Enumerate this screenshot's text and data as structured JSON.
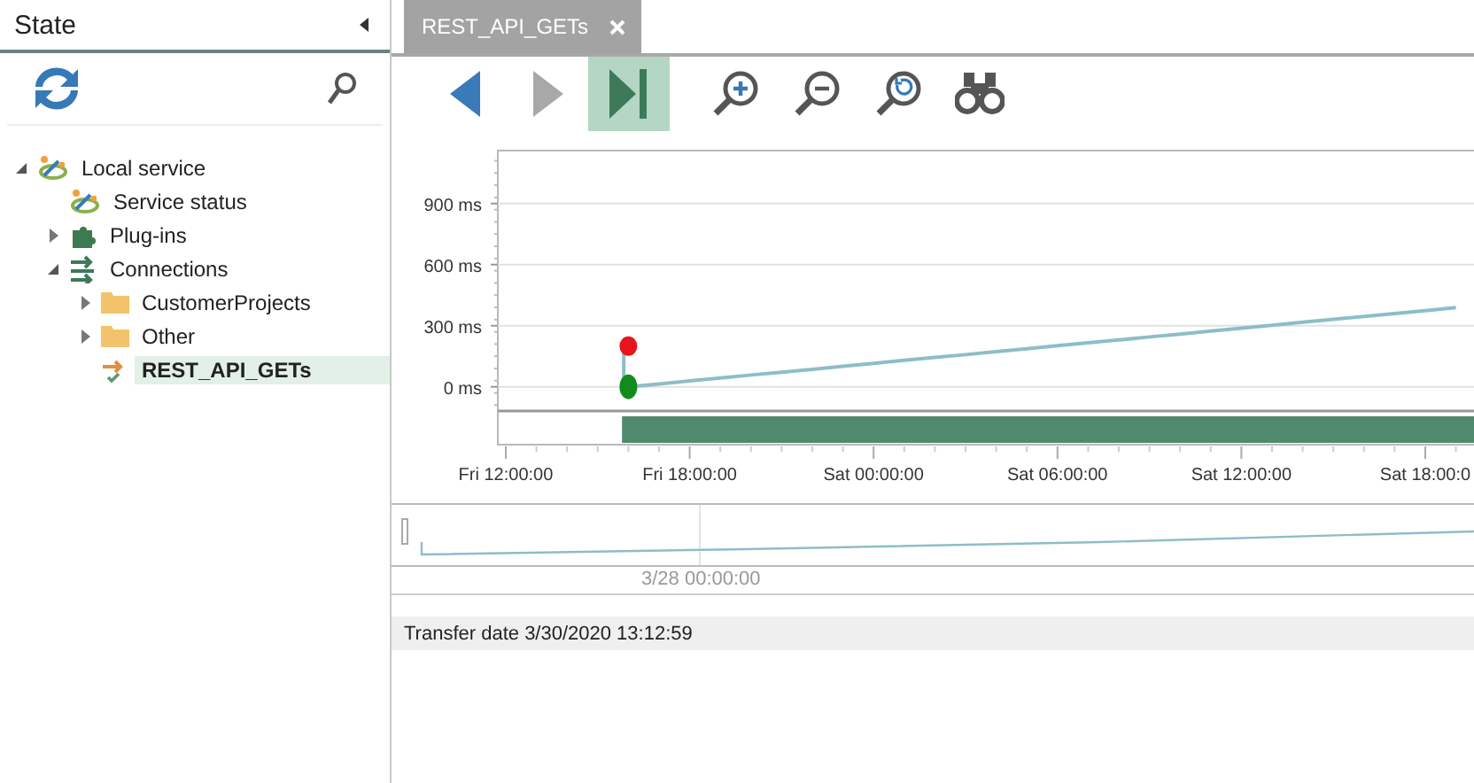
{
  "sidebar": {
    "title": "State",
    "tree": [
      {
        "label": "Local service",
        "kind": "service",
        "expanded": true,
        "selected": false,
        "children": [
          {
            "label": "Service status",
            "kind": "status",
            "selected": false
          },
          {
            "label": "Plug-ins",
            "kind": "plugin",
            "expanded": false,
            "selected": false
          },
          {
            "label": "Connections",
            "kind": "connections",
            "expanded": true,
            "selected": false,
            "children": [
              {
                "label": "CustomerProjects",
                "kind": "folder",
                "expanded": false,
                "selected": false
              },
              {
                "label": "Other",
                "kind": "folder",
                "expanded": false,
                "selected": false
              },
              {
                "label": "REST_API_GETs",
                "kind": "connection",
                "selected": true
              }
            ]
          }
        ]
      }
    ]
  },
  "tabs": [
    {
      "label": "REST_API_GETs",
      "selected": true
    }
  ],
  "toolbar": [
    {
      "kind": "back",
      "pressed": false,
      "disabled": false
    },
    {
      "kind": "forward",
      "pressed": false,
      "disabled": true
    },
    {
      "kind": "last",
      "pressed": true,
      "disabled": false
    },
    {
      "kind": "zoom-in",
      "pressed": false,
      "disabled": false
    },
    {
      "kind": "zoom-out",
      "pressed": false,
      "disabled": false
    },
    {
      "kind": "zoom-reset",
      "pressed": false,
      "disabled": false
    },
    {
      "kind": "find",
      "pressed": false,
      "disabled": false
    }
  ],
  "chart": {
    "chart_data": {
      "type": "line",
      "categories": [
        null,
        "Fri 12:00:00",
        null,
        null,
        null,
        null,
        null,
        "Fri 18:00:00",
        null,
        null,
        null,
        null,
        null,
        "Sat 00:00:00",
        null,
        null,
        null,
        null,
        null,
        "Sat 06:00:00",
        null,
        null,
        null,
        null,
        null,
        "Sat 12:00:00",
        null,
        null,
        null,
        null,
        null,
        "Sat 18:00:0",
        null
      ],
      "series": [
        {
          "color": "#8dbdc9",
          "values": [
            null,
            null,
            null,
            null,
            null,
            0,
            14,
            29,
            43,
            58,
            72,
            86,
            101,
            115,
            130,
            144,
            158,
            173,
            187,
            202,
            216,
            230,
            245,
            259,
            274,
            288,
            302,
            317,
            331,
            346,
            360,
            374,
            389
          ]
        },
        {
          "color": "#e8141b",
          "marker": "circle",
          "values": [
            null,
            null,
            null,
            null,
            null,
            200,
            null,
            null,
            null,
            null,
            null,
            null,
            null,
            null,
            null,
            null,
            null,
            null,
            null,
            null,
            null,
            null,
            null,
            null,
            null,
            null,
            null,
            null,
            null,
            null,
            null,
            null,
            null
          ]
        },
        {
          "color": "#138a1e",
          "marker": "circle",
          "values": [
            null,
            null,
            null,
            null,
            null,
            0,
            null,
            null,
            null,
            null,
            null,
            null,
            null,
            null,
            null,
            null,
            null,
            null,
            null,
            null,
            null,
            null,
            null,
            null,
            null,
            null,
            null,
            null,
            null,
            null,
            null,
            null,
            null
          ]
        }
      ],
      "yticks": [
        {
          "value": 0,
          "label": "0 ms"
        },
        {
          "value": 300,
          "label": "300 ms"
        },
        {
          "value": 600,
          "label": "600 ms"
        },
        {
          "value": 900,
          "label": "900 ms"
        }
      ],
      "ylim": [
        -110,
        1160
      ],
      "grid": true
    }
  },
  "overview": {
    "label": "3/28 00:00:00"
  },
  "status_bar": {
    "text": "Transfer date 3/30/2020 13:12:59"
  }
}
